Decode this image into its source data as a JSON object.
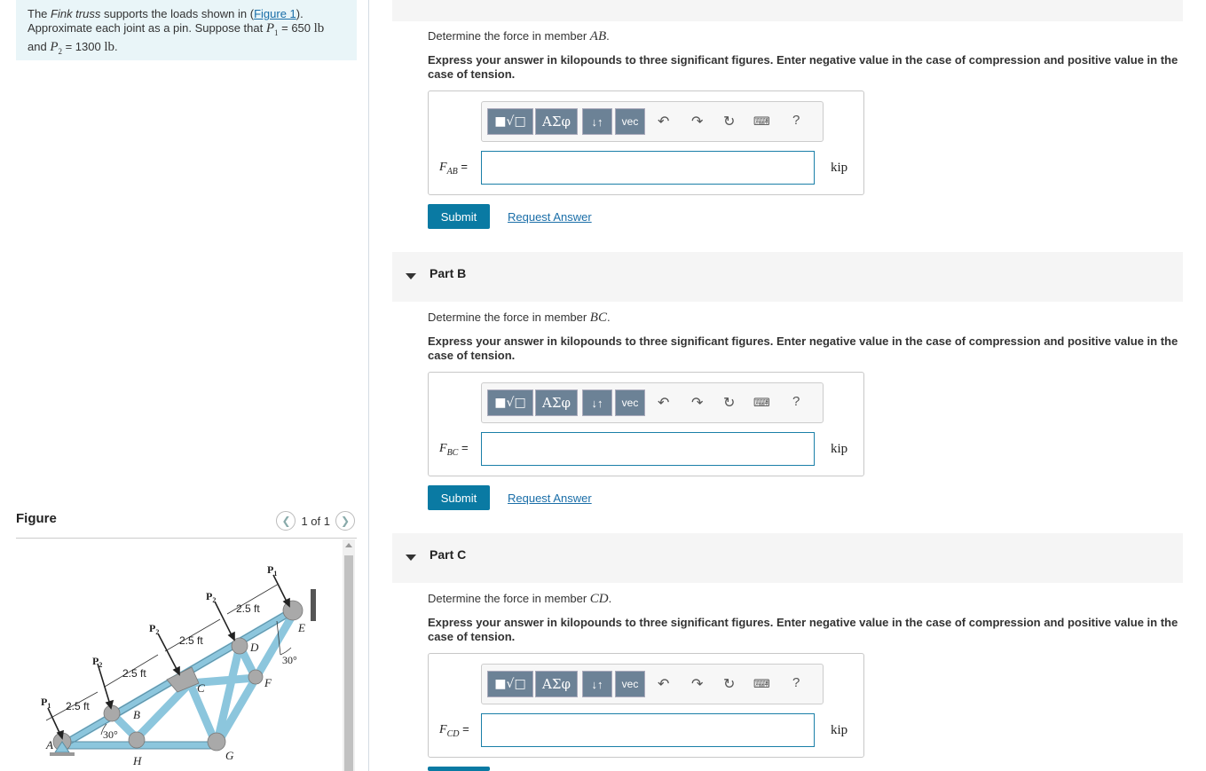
{
  "problem": {
    "text_before_truss": "The ",
    "truss_name": "Fink truss",
    "text_after_truss": " supports the loads shown in (",
    "figure_link": "Figure 1",
    "text_mid": "). Approximate each joint as a pin. Suppose that ",
    "p1_symbol": "P",
    "p1_sub": "1",
    "p1_value": " = 650 ",
    "unit_lb": "lb",
    "text_and": " and ",
    "p2_symbol": "P",
    "p2_sub": "2",
    "p2_value": " = 1300 ",
    "period": "."
  },
  "figure": {
    "title": "Figure",
    "pager": "1 of 1",
    "labels": {
      "P1_left": "P",
      "P1_top": "P",
      "P2": "P",
      "sub1": "1",
      "sub2": "2",
      "dim": "2.5 ft",
      "angle": "30°",
      "A": "A",
      "B": "B",
      "C": "C",
      "D": "D",
      "E": "E",
      "F": "F",
      "G": "G",
      "H": "H"
    }
  },
  "parts": [
    {
      "label": "",
      "question_prefix": "Determine the force in member ",
      "member": "AB",
      "question_suffix": ".",
      "instructions": "Express your answer in kilopounds to three significant figures. Enter negative value in the case of compression and positive value in the case of tension.",
      "var": "F",
      "var_sub": "AB",
      "eq": " =",
      "unit": "kip",
      "submit": "Submit",
      "request": "Request Answer"
    },
    {
      "label": "Part B",
      "question_prefix": "Determine the force in member ",
      "member": "BC",
      "question_suffix": ".",
      "instructions": "Express your answer in kilopounds to three significant figures. Enter negative value in the case of compression and positive value in the case of tension.",
      "var": "F",
      "var_sub": "BC",
      "eq": " =",
      "unit": "kip",
      "submit": "Submit",
      "request": "Request Answer"
    },
    {
      "label": "Part C",
      "question_prefix": "Determine the force in member ",
      "member": "CD",
      "question_suffix": ".",
      "instructions": "Express your answer in kilopounds to three significant figures. Enter negative value in the case of compression and positive value in the case of tension.",
      "var": "F",
      "var_sub": "CD",
      "eq": " =",
      "unit": "kip"
    }
  ],
  "toolbar": {
    "greek": "ΑΣφ",
    "arrows": "↓↑",
    "vec": "vec",
    "help": "?"
  }
}
